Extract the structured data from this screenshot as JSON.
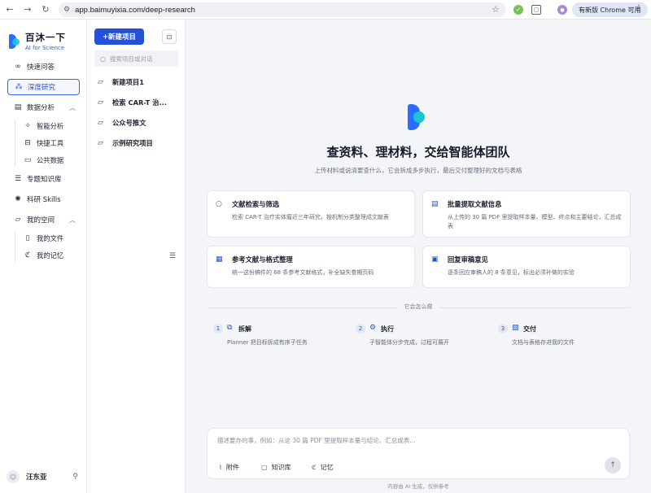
{
  "browser": {
    "url": "app.baimuyixia.com/deep-research",
    "update_label": "有新版 Chrome 可用"
  },
  "brand": {
    "name": "百沐一下",
    "tagline": "AI for Science"
  },
  "sidebar": {
    "items": [
      {
        "label": "快速问答",
        "icon": "chat-bubbles-icon"
      },
      {
        "label": "深度研究",
        "icon": "research-grid-icon",
        "active": true
      },
      {
        "label": "数据分析",
        "icon": "chart-icon",
        "expanded": true
      },
      {
        "label": "智能分析",
        "icon": "magic-wand-icon"
      },
      {
        "label": "快捷工具",
        "icon": "toolbox-icon"
      },
      {
        "label": "公共数据",
        "icon": "monitor-icon"
      },
      {
        "label": "专题知识库",
        "icon": "database-icon"
      },
      {
        "label": "科研 Skills",
        "icon": "sparkle-icon"
      },
      {
        "label": "我的空间",
        "icon": "folder-icon",
        "expanded": true
      },
      {
        "label": "我的文件",
        "icon": "file-icon"
      },
      {
        "label": "我的记忆",
        "icon": "memory-icon"
      }
    ],
    "user": {
      "name": "汪东亚"
    }
  },
  "projects": {
    "new_label": "+新建项目",
    "search_placeholder": "搜索项目或对话",
    "items": [
      "新建项目1",
      "检索 CAR-T 治...",
      "公众号推文",
      "示例研究项目"
    ]
  },
  "hero": {
    "title": "查资料、理材料，交给智能体团队",
    "subtitle": "上传材料或说清要查什么，它会拆成多步执行，最后交付整理好的文档与表格"
  },
  "cards": [
    {
      "title": "文献检索与筛选",
      "desc": "检索 CAR-T 治疗实体瘤近三年研究，按机制分类整理成文献表",
      "icon": "search-icon"
    },
    {
      "title": "批量提取文献信息",
      "desc": "从上传的 30 篇 PDF 里提取样本量、模型、终点和主要结论，汇总成表",
      "icon": "document-stack-icon"
    },
    {
      "title": "参考文献与格式整理",
      "desc": "统一这份稿件的 68 条参考文献格式，补全缺失卷期页码",
      "icon": "clipboard-icon"
    },
    {
      "title": "回复审稿意见",
      "desc": "逐条回应审稿人的 8 条意见，标出必须补做的实验",
      "icon": "comment-icon"
    }
  ],
  "how": {
    "label": "它会怎么做",
    "steps": [
      {
        "num": "1",
        "title": "拆解",
        "desc": "Planner 把目标拆成有序子任务",
        "icon": "split-icon"
      },
      {
        "num": "2",
        "title": "执行",
        "desc": "子智能体分步完成，过程可展开",
        "icon": "gear-icon"
      },
      {
        "num": "3",
        "title": "交付",
        "desc": "文档与表格存进我的文件",
        "icon": "deliver-icon"
      }
    ]
  },
  "composer": {
    "placeholder": "描述要办的事，例如：从这 30 篇 PDF 里提取样本量与结论、汇总成表...",
    "tools": [
      "附件",
      "知识库",
      "记忆"
    ]
  },
  "footnote": "内容由 AI 生成，仅供参考"
}
